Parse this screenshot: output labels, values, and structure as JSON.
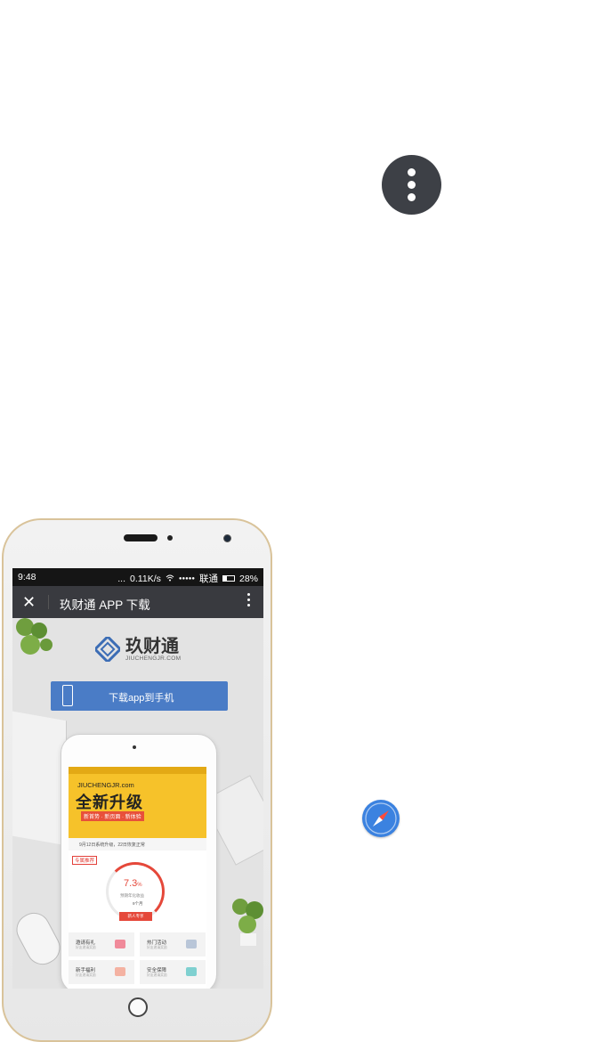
{
  "colors": {
    "menu_circle": "#3d4046",
    "safari_blue": "#3b82e0",
    "download_button": "#4a7cc6",
    "nav_bar": "#393a3f",
    "accent_red": "#e5483a",
    "banner_yellow": "#f6c22a"
  },
  "icons": {
    "menu": "more-vertical-icon",
    "safari": "safari-compass-icon"
  },
  "status_bar": {
    "time": "9:48",
    "dots": "...",
    "speed": "0.11K/s",
    "signal": "●●●●●",
    "carrier": "联通",
    "battery": "28%"
  },
  "nav": {
    "close": "✕",
    "title": "玖财通 APP 下载"
  },
  "page": {
    "logo_cn": "玖财通",
    "logo_en": "JIUCHENGJR.COM",
    "download_label": "下载app到手机"
  },
  "inner_app": {
    "banner_en": "JIUCHENGJR.com",
    "banner_title": "全新升级",
    "banner_tags": "新首势 · 新页面 · 新体验",
    "notice": "9月12日系统升级，22日恢复正常",
    "promo": "专属推荐",
    "rate": "7.3",
    "rate_unit": "%",
    "rate_sub": "预期年化收益",
    "term": "9个月",
    "buy": "新人专享",
    "grid": [
      {
        "label": "邀请有礼",
        "sub": "好友邀请奖励"
      },
      {
        "label": "热门活动",
        "sub": "好友邀请奖励"
      },
      {
        "label": "新手福利",
        "sub": "好友邀请奖励"
      },
      {
        "label": "安全保障",
        "sub": "好友邀请奖励"
      }
    ]
  }
}
